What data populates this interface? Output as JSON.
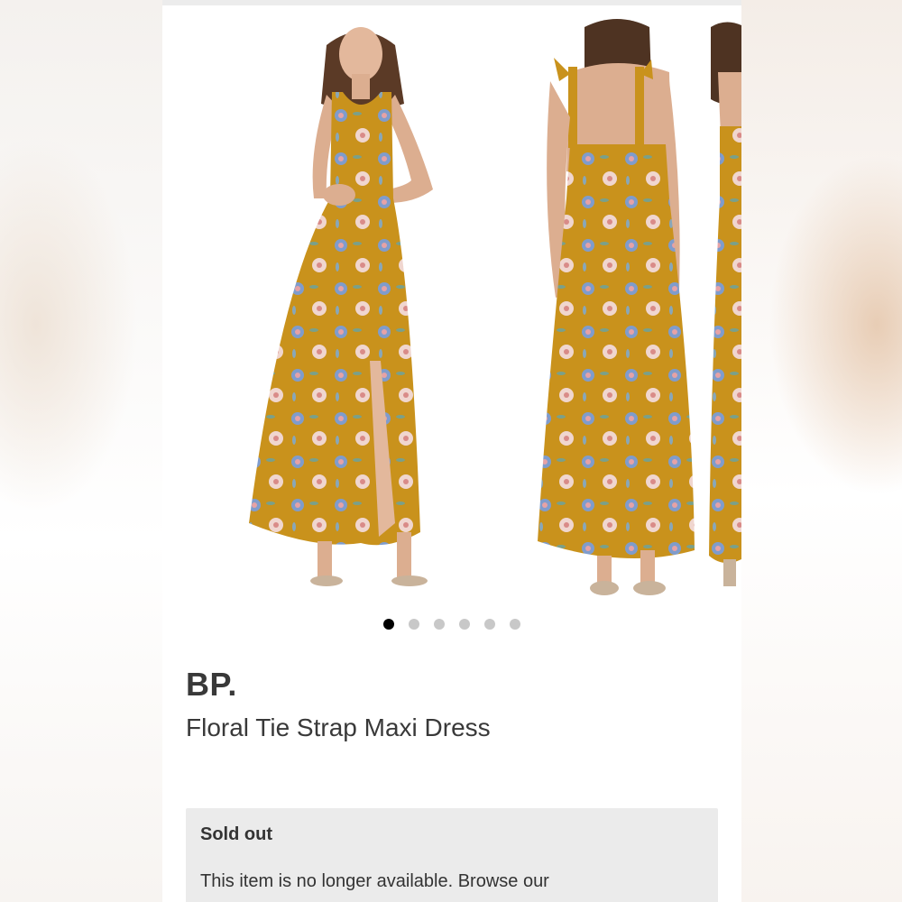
{
  "colors": {
    "dress_mustard": "#c9921c",
    "panel_gray": "#ebebeb",
    "text_dark": "#393939",
    "dot_active": "#000000",
    "dot_inactive": "#c8c8c8"
  },
  "carousel": {
    "slides": [
      {
        "description": "front-view-dress"
      },
      {
        "description": "back-view-dress"
      },
      {
        "description": "side-view-dress"
      }
    ],
    "dots": [
      true,
      false,
      false,
      false,
      false,
      false
    ]
  },
  "product": {
    "brand": "BP.",
    "name": "Floral Tie Strap Maxi Dress"
  },
  "notice": {
    "title": "Sold out",
    "text": "This item is no longer available. Browse our"
  }
}
